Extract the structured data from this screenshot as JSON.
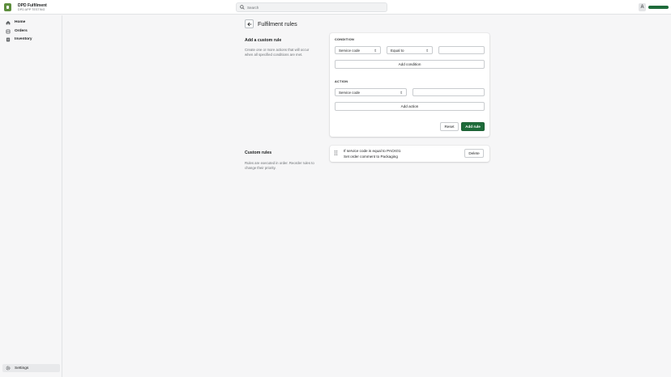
{
  "topbar": {
    "store_name": "DPD Fulfilment",
    "store_sub": "DPD APP TESTING",
    "search_placeholder": "Search",
    "avatar_initial": "A"
  },
  "sidebar": {
    "items": [
      {
        "label": "Home",
        "icon": "home-icon"
      },
      {
        "label": "Orders",
        "icon": "orders-icon"
      },
      {
        "label": "Inventory",
        "icon": "inventory-icon"
      }
    ],
    "settings_label": "Settings"
  },
  "page": {
    "title": "Fulfilment rules"
  },
  "add_rule_section": {
    "title": "Add a custom rule",
    "description": "Create one or more actions that will occur when all specified conditions are met.",
    "condition_label": "CONDITION",
    "condition_field": "Service code",
    "condition_operator": "Equal to",
    "condition_value": "",
    "add_condition_label": "Add condition",
    "action_label": "ACTION",
    "action_field": "Service code",
    "action_value": "",
    "add_action_label": "Add action",
    "reset_label": "Reset",
    "add_rule_label": "Add rule"
  },
  "custom_rules_section": {
    "title": "Custom rules",
    "description": "Rules are executed in order. Reorder rules to change their priority.",
    "rules": [
      {
        "line1": "If service code is equal to PACK01",
        "line2": "Set order comment to Packaging",
        "delete_label": "Delete"
      }
    ]
  },
  "colors": {
    "primary": "#1e6b3a",
    "background": "#f6f6f7"
  }
}
